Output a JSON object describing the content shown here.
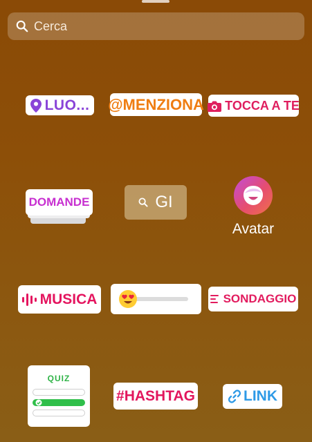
{
  "search": {
    "placeholder": "Cerca",
    "icon": "search-icon"
  },
  "stickers": {
    "luogo": {
      "label": "LUO...",
      "icon": "location-pin-icon",
      "color": "#8a44d8"
    },
    "menziona": {
      "label": "@MENZIONA",
      "color": "#ef7d12"
    },
    "tocca_a_te": {
      "label": "TOCCA A TE",
      "icon": "camera-icon",
      "color": "#df1e5e"
    },
    "domande": {
      "label": "DOMANDE",
      "color": "#c72fd0"
    },
    "gif": {
      "label": "GI",
      "icon": "search-icon"
    },
    "avatar": {
      "label": "Avatar",
      "icon": "avatar-face-icon"
    },
    "musica": {
      "label": "MUSICA",
      "icon": "music-bars-icon",
      "color": "#e4155f"
    },
    "slider": {
      "emoji": "heart-eyes-emoji-icon",
      "level": 0
    },
    "sondaggio": {
      "label": "SONDAGGIO",
      "icon": "poll-lines-icon",
      "color": "#e21b5e"
    },
    "quiz": {
      "label": "QUIZ",
      "options": 3,
      "correct_option": 2,
      "color": "#2fb347"
    },
    "hashtag": {
      "label": "#HASHTAG",
      "color": "#e2165d"
    },
    "link": {
      "label": "LINK",
      "icon": "link-chain-icon",
      "color": "#2e9ae6"
    }
  }
}
